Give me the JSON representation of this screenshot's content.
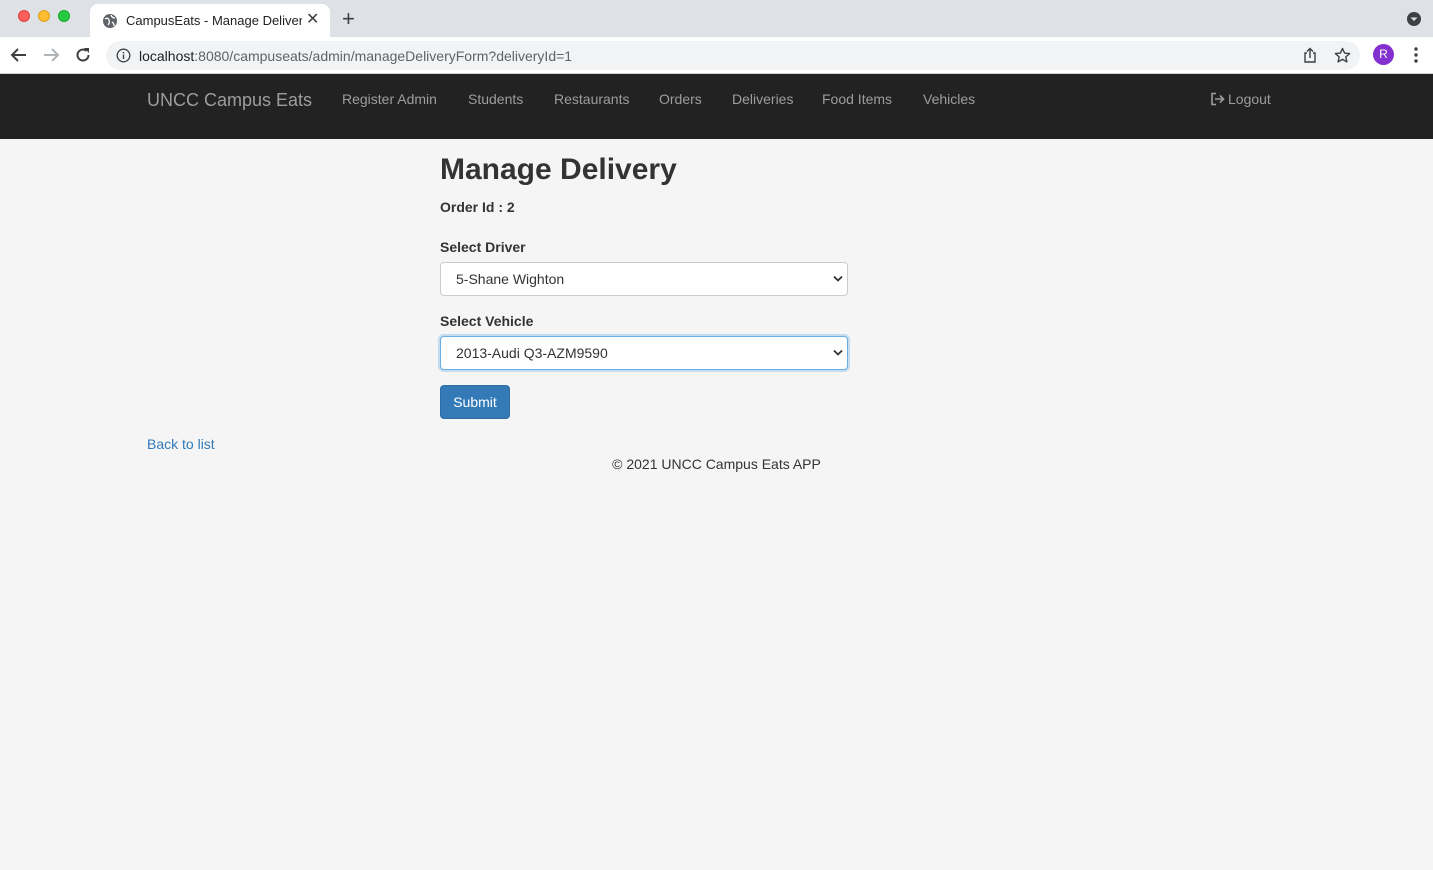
{
  "browser": {
    "tab_title": "CampusEats - Manage Delivery",
    "url_host": "localhost",
    "url_rest": ":8080/campuseats/admin/manageDeliveryForm?deliveryId=1",
    "profile_initial": "R"
  },
  "navbar": {
    "brand": "UNCC Campus Eats",
    "links": [
      {
        "label": "Register Admin"
      },
      {
        "label": "Students"
      },
      {
        "label": "Restaurants"
      },
      {
        "label": "Orders"
      },
      {
        "label": "Deliveries"
      },
      {
        "label": "Food Items"
      },
      {
        "label": "Vehicles"
      }
    ],
    "logout_label": "Logout"
  },
  "form": {
    "title": "Manage Delivery",
    "order_id_text": "Order Id : 2",
    "driver_label": "Select Driver",
    "driver_value": "5-Shane Wighton",
    "vehicle_label": "Select Vehicle",
    "vehicle_value": "2013-Audi Q3-AZM9590",
    "submit_label": "Submit"
  },
  "back_link": "Back to list",
  "footer": "© 2021 UNCC Campus Eats APP",
  "colors": {
    "navbar_bg": "#222222",
    "primary": "#337ab7",
    "page_bg": "#f5f5f5"
  }
}
